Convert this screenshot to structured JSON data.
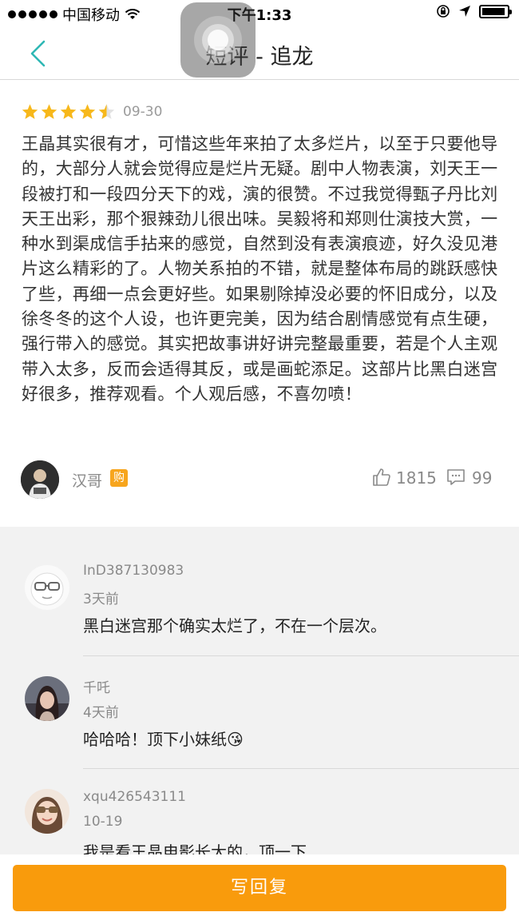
{
  "status_bar": {
    "carrier": "中国移动",
    "time": "下午1:33"
  },
  "nav": {
    "title": "短评 - 追龙"
  },
  "review": {
    "rating": 4.5,
    "date": "09-30",
    "text": "王晶其实很有才，可惜这些年来拍了太多烂片，以至于只要他导的，大部分人就会觉得应是烂片无疑。剧中人物表演，刘天王一段被打和一段四分天下的戏，演的很赞。不过我觉得甄子丹比刘天王出彩，那个狠辣劲儿很出味。吴毅将和郑则仕演技大赏，一种水到渠成信手拈来的感觉，自然到没有表演痕迹，好久没见港片这么精彩的了。人物关系拍的不错，就是整体布局的跳跃感快了些，再细一点会更好些。如果剔除掉没必要的怀旧成分，以及徐冬冬的这个人设，也许更完美，因为结合剧情感觉有点生硬，强行带入的感觉。其实把故事讲好讲完整最重要，若是个人主观带入太多，反而会适得其反，或是画蛇添足。这部片比黑白迷宫好很多，推荐观看。个人观后感，不喜勿喷！",
    "author": "汉哥",
    "badge": "购",
    "likes": "1815",
    "comments": "99"
  },
  "replies": [
    {
      "user": "InD387130983",
      "date": "3天前",
      "text": "黑白迷宫那个确实太烂了，不在一个层次。"
    },
    {
      "user": "千吒",
      "date": "4天前",
      "text": "哈哈哈！顶下小妹纸😘"
    },
    {
      "user": "xqu426543111",
      "date": "10-19",
      "text": "我是看王晶电影长大的，顶一下"
    }
  ],
  "footer": {
    "button_label": "写回复"
  },
  "colors": {
    "accent": "#f99b0c",
    "star": "#f7b81b",
    "back": "#2eb8b4"
  }
}
